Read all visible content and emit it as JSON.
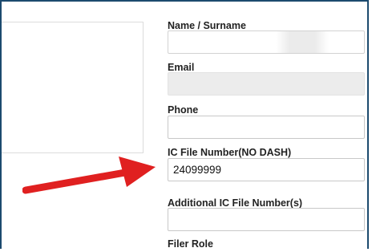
{
  "form": {
    "name_label": "Name / Surname",
    "name_value": "",
    "email_label": "Email",
    "email_value": "",
    "phone_label": "Phone",
    "phone_value": "",
    "ic_label": "IC File Number(NO DASH)",
    "ic_value": "24099999",
    "additional_ic_label": "Additional IC File Number(s)",
    "additional_ic_value": "",
    "filer_role_label": "Filer Role"
  },
  "colors": {
    "frame": "#1c4a6e",
    "arrow": "#e02020"
  }
}
